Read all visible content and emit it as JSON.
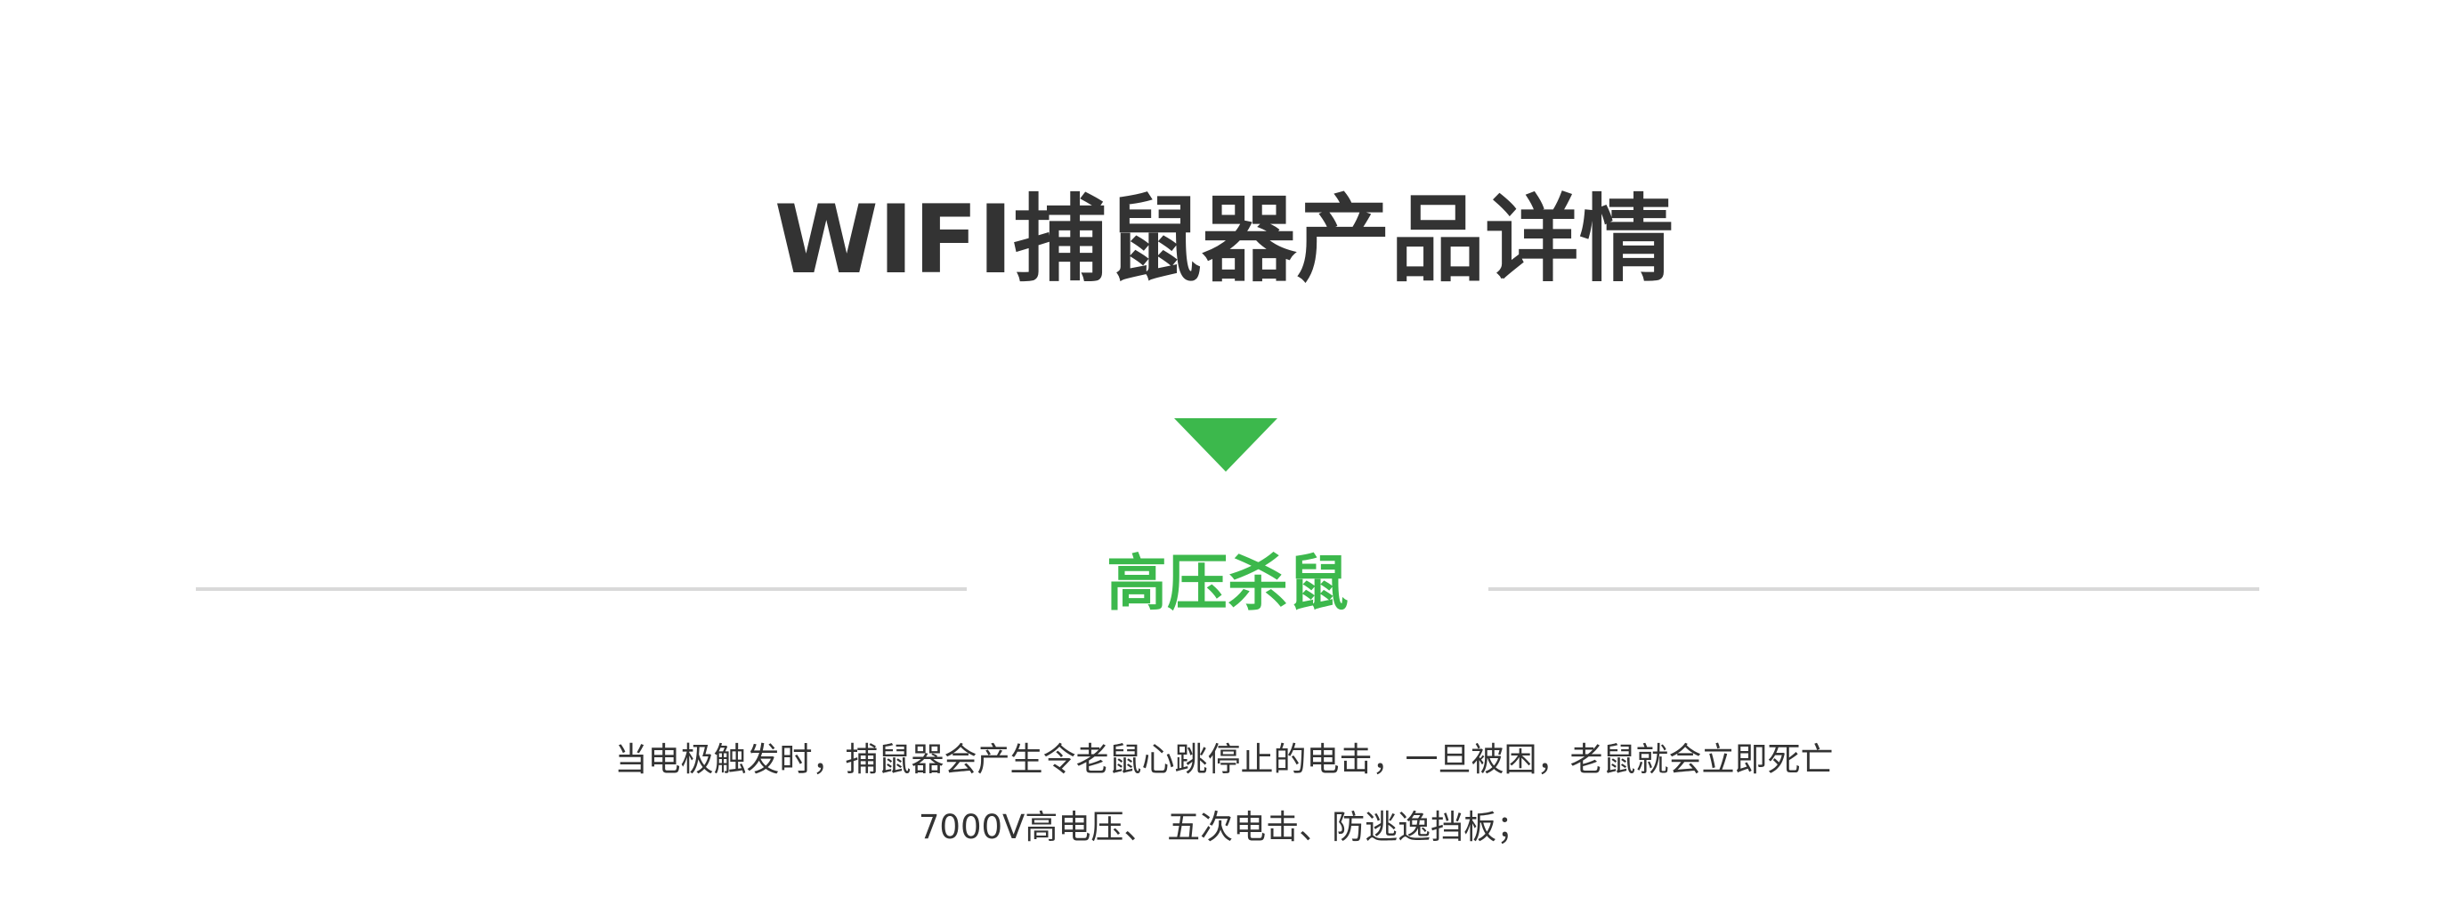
{
  "header": {
    "title": "WIFI捕鼠器产品详情"
  },
  "section": {
    "title": "高压杀鼠",
    "description_lines": [
      "当电极触发时，捕鼠器会产生令老鼠心跳停止的电击，一旦被困，老鼠就会立即死亡",
      "7000V高电压、 五次电击、防逃逸挡板；"
    ]
  },
  "colors": {
    "accent": "#3cb84c",
    "text": "#333333",
    "divider": "#d9d9d9",
    "background": "#ffffff"
  },
  "icons": {
    "arrow": "triangle-down-icon"
  }
}
